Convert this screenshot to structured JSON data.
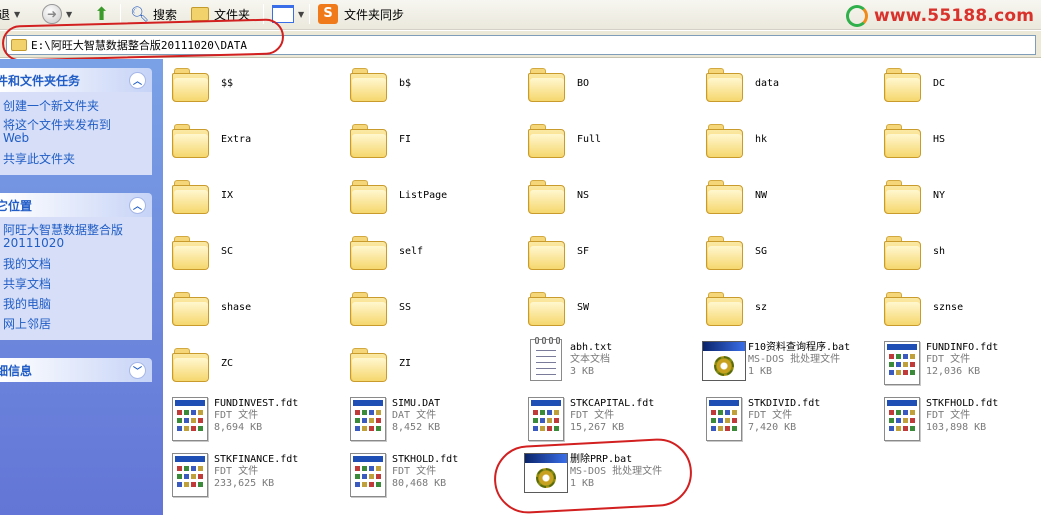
{
  "toolbar": {
    "back_label": "退",
    "search_label": "搜索",
    "folders_label": "文件夹",
    "sync_label": "文件夹同步",
    "logo_text": "www.55188.com"
  },
  "address": {
    "path": "E:\\阿旺大智慧数据整合版20111020\\DATA"
  },
  "left_panel": {
    "tasks": {
      "title": "件和文件夹任务",
      "items": [
        "创建一个新文件夹",
        "将这个文件夹发布到\nWeb",
        "共享此文件夹"
      ]
    },
    "other_places": {
      "title": "它位置",
      "items": [
        "阿旺大智慧数据整合版\n20111020",
        "我的文档",
        "共享文档",
        "我的电脑",
        "网上邻居"
      ]
    },
    "details": {
      "title": "细信息"
    }
  },
  "folders": [
    "$$",
    "b$",
    "BO",
    "data",
    "DC",
    "Extra",
    "FI",
    "Full",
    "hk",
    "HS",
    "IX",
    "ListPage",
    "NS",
    "NW",
    "NY",
    "SC",
    "self",
    "SF",
    "SG",
    "sh",
    "shase",
    "SS",
    "SW",
    "sz",
    "sznse",
    "ZC",
    "ZI"
  ],
  "files": [
    {
      "name": "abh.txt",
      "type": "文本文档",
      "size": "3 KB",
      "icon": "text-icon"
    },
    {
      "name": "F10资料查询程序.bat",
      "type": "MS-DOS 批处理文件",
      "size": "1 KB",
      "icon": "batch-icon"
    },
    {
      "name": "FUNDINFO.fdt",
      "type": "FDT 文件",
      "size": "12,036 KB",
      "icon": "fdt-icon"
    },
    {
      "name": "FUNDINVEST.fdt",
      "type": "FDT 文件",
      "size": "8,694 KB",
      "icon": "fdt-icon"
    },
    {
      "name": "SIMU.DAT",
      "type": "DAT 文件",
      "size": "8,452 KB",
      "icon": "fdt-icon"
    },
    {
      "name": "STKCAPITAL.fdt",
      "type": "FDT 文件",
      "size": "15,267 KB",
      "icon": "fdt-icon"
    },
    {
      "name": "STKDIVID.fdt",
      "type": "FDT 文件",
      "size": "7,420 KB",
      "icon": "fdt-icon"
    },
    {
      "name": "STKFHOLD.fdt",
      "type": "FDT 文件",
      "size": "103,898 KB",
      "icon": "fdt-icon"
    },
    {
      "name": "STKFINANCE.fdt",
      "type": "FDT 文件",
      "size": "233,625 KB",
      "icon": "fdt-icon"
    },
    {
      "name": "STKHOLD.fdt",
      "type": "FDT 文件",
      "size": "80,468 KB",
      "icon": "fdt-icon"
    },
    {
      "name": "删除PRP.bat",
      "type": "MS-DOS 批处理文件",
      "size": "1 KB",
      "icon": "batch-icon"
    }
  ]
}
